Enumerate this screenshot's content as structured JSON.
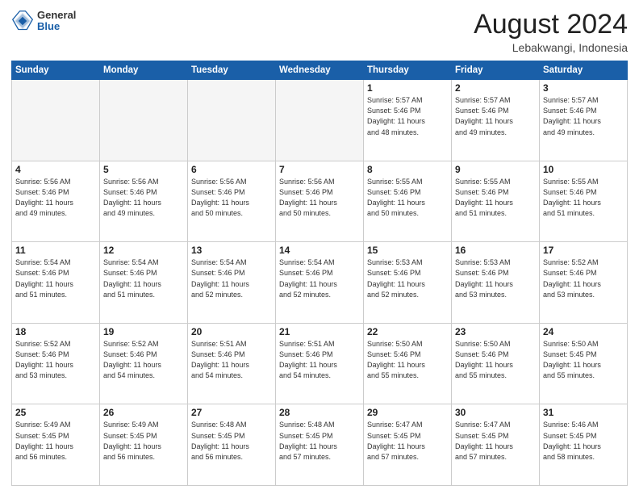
{
  "logo": {
    "general": "General",
    "blue": "Blue"
  },
  "title": "August 2024",
  "location": "Lebakwangi, Indonesia",
  "header_days": [
    "Sunday",
    "Monday",
    "Tuesday",
    "Wednesday",
    "Thursday",
    "Friday",
    "Saturday"
  ],
  "weeks": [
    [
      {
        "day": "",
        "info": ""
      },
      {
        "day": "",
        "info": ""
      },
      {
        "day": "",
        "info": ""
      },
      {
        "day": "",
        "info": ""
      },
      {
        "day": "1",
        "info": "Sunrise: 5:57 AM\nSunset: 5:46 PM\nDaylight: 11 hours\nand 48 minutes."
      },
      {
        "day": "2",
        "info": "Sunrise: 5:57 AM\nSunset: 5:46 PM\nDaylight: 11 hours\nand 49 minutes."
      },
      {
        "day": "3",
        "info": "Sunrise: 5:57 AM\nSunset: 5:46 PM\nDaylight: 11 hours\nand 49 minutes."
      }
    ],
    [
      {
        "day": "4",
        "info": "Sunrise: 5:56 AM\nSunset: 5:46 PM\nDaylight: 11 hours\nand 49 minutes."
      },
      {
        "day": "5",
        "info": "Sunrise: 5:56 AM\nSunset: 5:46 PM\nDaylight: 11 hours\nand 49 minutes."
      },
      {
        "day": "6",
        "info": "Sunrise: 5:56 AM\nSunset: 5:46 PM\nDaylight: 11 hours\nand 50 minutes."
      },
      {
        "day": "7",
        "info": "Sunrise: 5:56 AM\nSunset: 5:46 PM\nDaylight: 11 hours\nand 50 minutes."
      },
      {
        "day": "8",
        "info": "Sunrise: 5:55 AM\nSunset: 5:46 PM\nDaylight: 11 hours\nand 50 minutes."
      },
      {
        "day": "9",
        "info": "Sunrise: 5:55 AM\nSunset: 5:46 PM\nDaylight: 11 hours\nand 51 minutes."
      },
      {
        "day": "10",
        "info": "Sunrise: 5:55 AM\nSunset: 5:46 PM\nDaylight: 11 hours\nand 51 minutes."
      }
    ],
    [
      {
        "day": "11",
        "info": "Sunrise: 5:54 AM\nSunset: 5:46 PM\nDaylight: 11 hours\nand 51 minutes."
      },
      {
        "day": "12",
        "info": "Sunrise: 5:54 AM\nSunset: 5:46 PM\nDaylight: 11 hours\nand 51 minutes."
      },
      {
        "day": "13",
        "info": "Sunrise: 5:54 AM\nSunset: 5:46 PM\nDaylight: 11 hours\nand 52 minutes."
      },
      {
        "day": "14",
        "info": "Sunrise: 5:54 AM\nSunset: 5:46 PM\nDaylight: 11 hours\nand 52 minutes."
      },
      {
        "day": "15",
        "info": "Sunrise: 5:53 AM\nSunset: 5:46 PM\nDaylight: 11 hours\nand 52 minutes."
      },
      {
        "day": "16",
        "info": "Sunrise: 5:53 AM\nSunset: 5:46 PM\nDaylight: 11 hours\nand 53 minutes."
      },
      {
        "day": "17",
        "info": "Sunrise: 5:52 AM\nSunset: 5:46 PM\nDaylight: 11 hours\nand 53 minutes."
      }
    ],
    [
      {
        "day": "18",
        "info": "Sunrise: 5:52 AM\nSunset: 5:46 PM\nDaylight: 11 hours\nand 53 minutes."
      },
      {
        "day": "19",
        "info": "Sunrise: 5:52 AM\nSunset: 5:46 PM\nDaylight: 11 hours\nand 54 minutes."
      },
      {
        "day": "20",
        "info": "Sunrise: 5:51 AM\nSunset: 5:46 PM\nDaylight: 11 hours\nand 54 minutes."
      },
      {
        "day": "21",
        "info": "Sunrise: 5:51 AM\nSunset: 5:46 PM\nDaylight: 11 hours\nand 54 minutes."
      },
      {
        "day": "22",
        "info": "Sunrise: 5:50 AM\nSunset: 5:46 PM\nDaylight: 11 hours\nand 55 minutes."
      },
      {
        "day": "23",
        "info": "Sunrise: 5:50 AM\nSunset: 5:46 PM\nDaylight: 11 hours\nand 55 minutes."
      },
      {
        "day": "24",
        "info": "Sunrise: 5:50 AM\nSunset: 5:45 PM\nDaylight: 11 hours\nand 55 minutes."
      }
    ],
    [
      {
        "day": "25",
        "info": "Sunrise: 5:49 AM\nSunset: 5:45 PM\nDaylight: 11 hours\nand 56 minutes."
      },
      {
        "day": "26",
        "info": "Sunrise: 5:49 AM\nSunset: 5:45 PM\nDaylight: 11 hours\nand 56 minutes."
      },
      {
        "day": "27",
        "info": "Sunrise: 5:48 AM\nSunset: 5:45 PM\nDaylight: 11 hours\nand 56 minutes."
      },
      {
        "day": "28",
        "info": "Sunrise: 5:48 AM\nSunset: 5:45 PM\nDaylight: 11 hours\nand 57 minutes."
      },
      {
        "day": "29",
        "info": "Sunrise: 5:47 AM\nSunset: 5:45 PM\nDaylight: 11 hours\nand 57 minutes."
      },
      {
        "day": "30",
        "info": "Sunrise: 5:47 AM\nSunset: 5:45 PM\nDaylight: 11 hours\nand 57 minutes."
      },
      {
        "day": "31",
        "info": "Sunrise: 5:46 AM\nSunset: 5:45 PM\nDaylight: 11 hours\nand 58 minutes."
      }
    ]
  ]
}
